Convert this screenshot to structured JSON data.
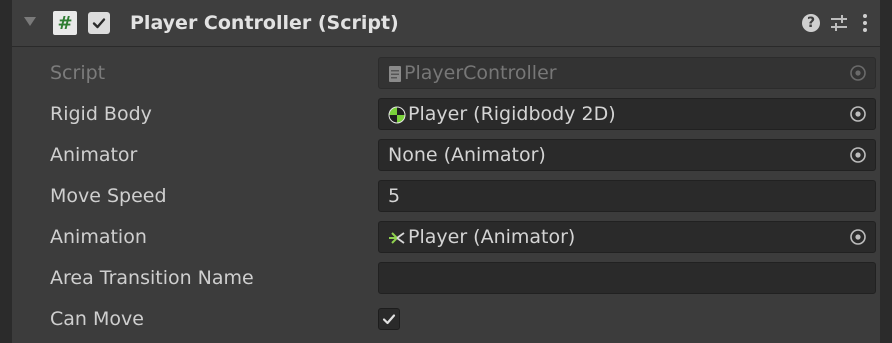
{
  "component": {
    "title": "Player Controller (Script)",
    "enabled": true,
    "script_icon_glyph": "#"
  },
  "icons": {
    "foldout": "foldout-triangle-icon",
    "help": "help-icon",
    "presets": "presets-sliders-icon",
    "menu": "kebab-menu-icon"
  },
  "colors": {
    "panel_bg": "#3c3c3c",
    "field_bg": "#2a2a2a",
    "script_icon": "#2f7d32",
    "rigidbody_icon": "#7ad13a",
    "animator_icon": "#8fd14f"
  },
  "fields": {
    "script": {
      "label": "Script",
      "value": "PlayerController"
    },
    "rigid_body": {
      "label": "Rigid Body",
      "value": "Player (Rigidbody 2D)"
    },
    "animator": {
      "label": "Animator",
      "value": "None (Animator)"
    },
    "move_speed": {
      "label": "Move Speed",
      "value": "5"
    },
    "animation": {
      "label": "Animation",
      "value": "Player (Animator)"
    },
    "area_transition_name": {
      "label": "Area Transition Name",
      "value": ""
    },
    "can_move": {
      "label": "Can Move",
      "checked": true
    }
  }
}
